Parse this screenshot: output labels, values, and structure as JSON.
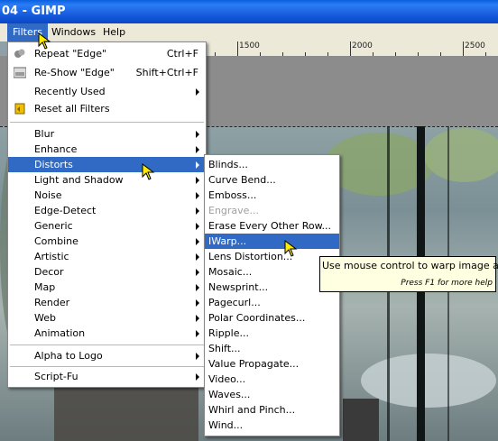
{
  "window": {
    "title": "04 - GIMP"
  },
  "menubar": {
    "items": [
      "Filters",
      "Windows",
      "Help"
    ]
  },
  "ruler": {
    "labels": [
      "1500",
      "2000",
      "2500"
    ]
  },
  "filters_menu": {
    "items": [
      {
        "label": "Repeat \"Edge\"",
        "shortcut": "Ctrl+F",
        "icon": "repeat-filter-icon"
      },
      {
        "label": "Re-Show \"Edge\"",
        "shortcut": "Shift+Ctrl+F",
        "icon": "reshow-filter-icon"
      },
      {
        "label": "Recently Used",
        "submenu": true
      },
      {
        "label": "Reset all Filters",
        "icon": "reset-filters-icon"
      },
      {
        "label": "Blur",
        "submenu": true
      },
      {
        "label": "Enhance",
        "submenu": true
      },
      {
        "label": "Distorts",
        "submenu": true,
        "highlighted": true
      },
      {
        "label": "Light and Shadow",
        "submenu": true
      },
      {
        "label": "Noise",
        "submenu": true
      },
      {
        "label": "Edge-Detect",
        "submenu": true
      },
      {
        "label": "Generic",
        "submenu": true
      },
      {
        "label": "Combine",
        "submenu": true
      },
      {
        "label": "Artistic",
        "submenu": true
      },
      {
        "label": "Decor",
        "submenu": true
      },
      {
        "label": "Map",
        "submenu": true
      },
      {
        "label": "Render",
        "submenu": true
      },
      {
        "label": "Web",
        "submenu": true
      },
      {
        "label": "Animation",
        "submenu": true
      },
      {
        "label": "Alpha to Logo",
        "submenu": true
      },
      {
        "label": "Script-Fu",
        "submenu": true
      }
    ]
  },
  "distorts_menu": {
    "items": [
      {
        "label": "Blinds..."
      },
      {
        "label": "Curve Bend..."
      },
      {
        "label": "Emboss..."
      },
      {
        "label": "Engrave...",
        "disabled": true
      },
      {
        "label": "Erase Every Other Row..."
      },
      {
        "label": "IWarp...",
        "highlighted": true
      },
      {
        "label": "Lens Distortion..."
      },
      {
        "label": "Mosaic..."
      },
      {
        "label": "Newsprint..."
      },
      {
        "label": "Pagecurl..."
      },
      {
        "label": "Polar Coordinates..."
      },
      {
        "label": "Ripple..."
      },
      {
        "label": "Shift..."
      },
      {
        "label": "Value Propagate..."
      },
      {
        "label": "Video..."
      },
      {
        "label": "Waves..."
      },
      {
        "label": "Whirl and Pinch..."
      },
      {
        "label": "Wind..."
      }
    ]
  },
  "tooltip": {
    "text": "Use mouse control to warp image areas",
    "help": "Press F1 for more help"
  },
  "colors": {
    "highlight": "#316ac5",
    "menubar": "#ece9d8",
    "tooltip": "#ffffe1"
  }
}
